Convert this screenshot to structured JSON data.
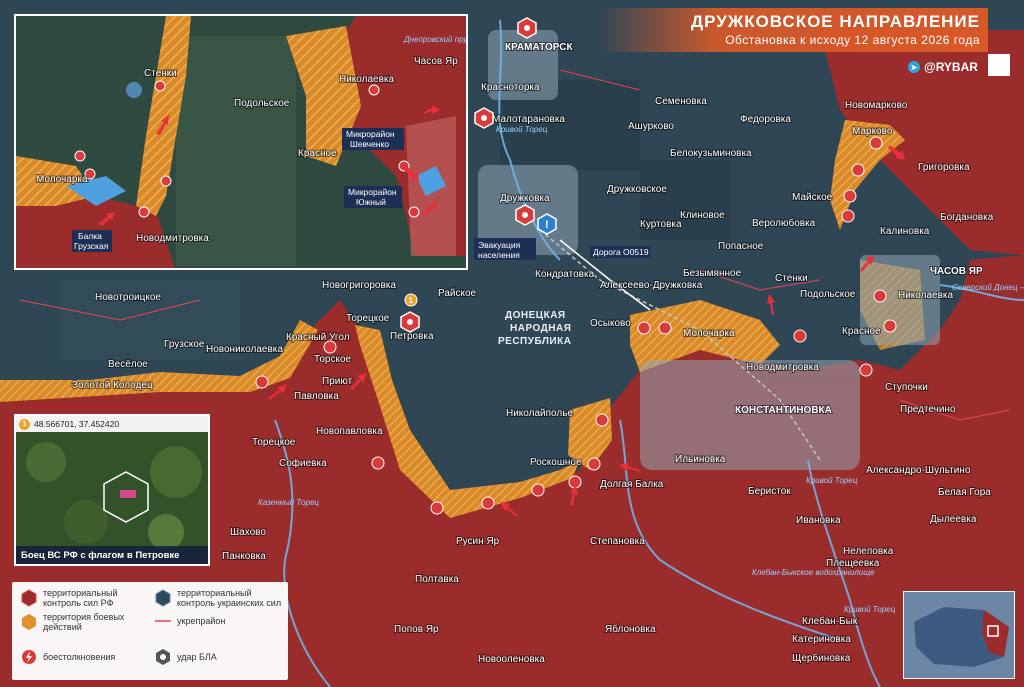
{
  "header": {
    "title": "ДРУЖКОВСКОЕ НАПРАВЛЕНИЕ",
    "subtitle": "Обстановка к исходу 12 августа 2026 года"
  },
  "brand": {
    "handle": "@RYBAR",
    "icon": "telegram-icon"
  },
  "colors": {
    "russian": "#9b2c2c",
    "ukrainian": "#2f4a5c",
    "contested": "#e0922e",
    "clash": "#d93a3a",
    "fortification": "#e0455a"
  },
  "main_map": {
    "region_label": [
      "ДОНЕЦКАЯ",
      "НАРОДНАЯ",
      "РЕСПУБЛИКА"
    ],
    "cities": [
      "КРАМАТОРСК",
      "КОНСТАНТИНОВКА",
      "ЧАСОВ ЯР"
    ],
    "settlements": [
      "Красноторка",
      "Малотарановка",
      "Семеновка",
      "Ашурково",
      "Федоровка",
      "Новомарково",
      "Марково",
      "Белокузьминовка",
      "Григоровка",
      "Дружковка",
      "Дружковское",
      "Куртовка",
      "Клиновое",
      "Веролюбовка",
      "Майское",
      "Богдановка",
      "Калиновка",
      "Попасное",
      "Кондратовка",
      "Безымянное",
      "Стенки",
      "Подольское",
      "Николаевка",
      "Алексеево-Дружковка",
      "Новогригоровка",
      "Райское",
      "Торецкое",
      "Петровка",
      "Осыково",
      "Молочарка",
      "Красное",
      "Новотроицкое",
      "Красный Угол",
      "Новониколаевка",
      "Торское",
      "Грузское",
      "Новодмитровка",
      "Ступочки",
      "Весёлое",
      "Приют",
      "Предтечино",
      "Золотой Колодец",
      "Павловка",
      "Новопавловка",
      "Николайполье",
      "Торецкое",
      "Софиевка",
      "Роскошное",
      "Долгая Балка",
      "Ильиновка",
      "Александро-Шультино",
      "Беристок",
      "Белая Гора",
      "Шахово",
      "Ивановка",
      "Дылеевка",
      "Русин Яр",
      "Степановка",
      "Нелеповка",
      "Панковка",
      "Плещеевка",
      "Полтавка",
      "Клебан-Бык",
      "Попов Яр",
      "Яблоновка",
      "Катериновка",
      "Новооленовка",
      "Щербиновка"
    ],
    "water": [
      "Кривой Торец",
      "Казенный Торец",
      "Кривой Торец",
      "Клебан-Быкское водохранилище",
      "Северский Донец – Донбасс",
      "Кривой Торец"
    ],
    "callouts": {
      "evacuation": "Эвакуация населения",
      "road": "Дорога О0519",
      "marker_num": "1"
    }
  },
  "inset": {
    "settlements": [
      "Стенки",
      "Подольское",
      "Николаевка",
      "Часов Яр",
      "Красное",
      "Молочарка",
      "Новодмитровка"
    ],
    "labels": {
      "pond": "Днепровский пруд",
      "mkr_shevchenko": "Микрорайон Шевченко",
      "mkr_yuzhny": "Микрорайон Южный",
      "balka": "Балка Грузская"
    }
  },
  "photo": {
    "number": "1",
    "coords": "48.566701, 37.452420",
    "caption": "Боец ВС РФ с флагом в Петровке"
  },
  "legend": {
    "russian_control": "территориальный контроль сил РФ",
    "ukrainian_control": "территориальный контроль украинских сил",
    "combat_zone": "территория боевых действий",
    "fortification": "укрепрайон",
    "clashes": "боестолкновения",
    "drone_strike": "удар БЛА"
  }
}
